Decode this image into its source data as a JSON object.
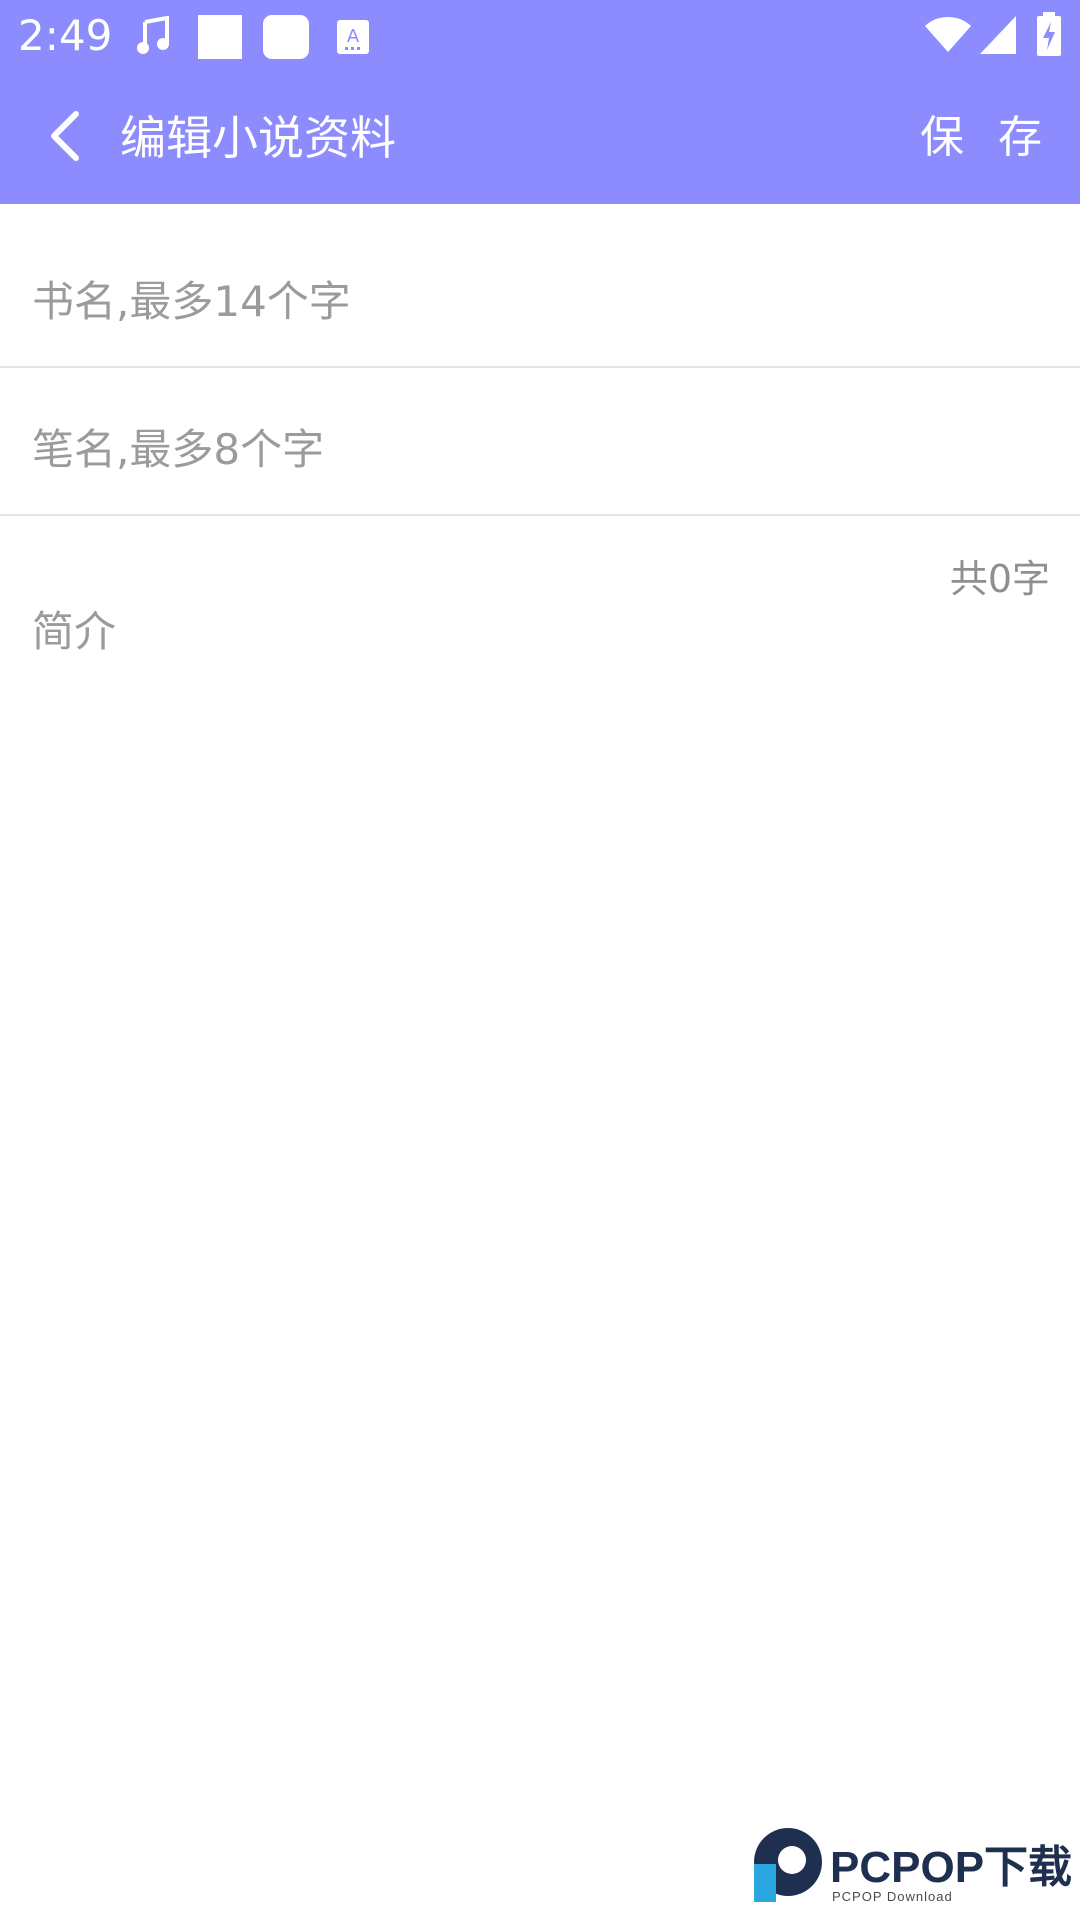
{
  "status_bar": {
    "time": "2:49",
    "icons": [
      "music-icon",
      "square-icon",
      "rounded-square-icon",
      "keyboard-a-icon",
      "wifi-icon",
      "signal-icon",
      "battery-charging-icon"
    ]
  },
  "app_bar": {
    "title": "编辑小说资料",
    "save_label": "保 存",
    "back_icon": "chevron-left-icon"
  },
  "form": {
    "book_title": {
      "value": "",
      "placeholder": "书名,最多14个字"
    },
    "pen_name": {
      "value": "",
      "placeholder": "笔名,最多8个字"
    },
    "intro": {
      "value": "",
      "placeholder": "简介",
      "counter": "共0字"
    }
  },
  "watermark": {
    "brand": "PCPOP下载",
    "subtitle": "PCPOP Download"
  },
  "colors": {
    "accent": "#8c8cff",
    "divider": "#e5e5e5",
    "placeholder": "#9b9b9b"
  }
}
